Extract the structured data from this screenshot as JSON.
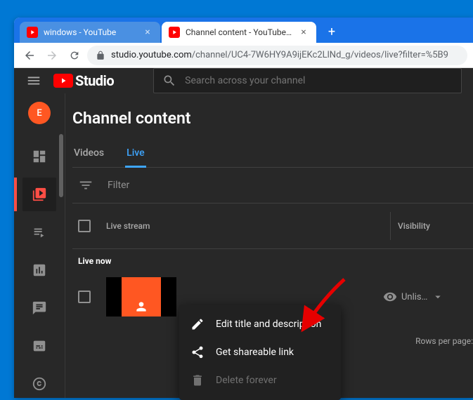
{
  "browser": {
    "tabs": [
      {
        "title": "windows - YouTube"
      },
      {
        "title": "Channel content - YouTube Studio"
      }
    ],
    "url_host": "studio.youtube.com",
    "url_path": "/channel/UC4-7W6HY9A9ijEKc2LlNd_g/videos/live?filter=%5B9"
  },
  "header": {
    "logo_text": "Studio",
    "search_placeholder": "Search across your channel"
  },
  "sidebar": {
    "avatar_letter": "E"
  },
  "page": {
    "title": "Channel content",
    "tabs": [
      {
        "label": "Videos"
      },
      {
        "label": "Live"
      }
    ],
    "filter_label": "Filter",
    "columns": {
      "stream": "Live stream",
      "visibility": "Visibility"
    },
    "section": "Live now",
    "row": {
      "visibility": "Unlis…"
    },
    "rows_per_page": "Rows per page:"
  },
  "menu": {
    "edit": "Edit title and description",
    "share": "Get shareable link",
    "delete": "Delete forever"
  }
}
